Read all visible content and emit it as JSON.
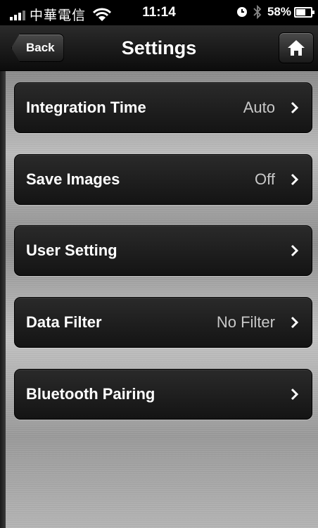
{
  "status_bar": {
    "carrier": "中華電信",
    "time": "11:14",
    "battery": "58%",
    "battery_level": 0.58,
    "signal_icon": "signal-bars-icon",
    "wifi_icon": "wifi-icon",
    "clock_icon": "clock-icon",
    "bluetooth_icon": "bluetooth-icon"
  },
  "nav": {
    "back_label": "Back",
    "title": "Settings",
    "home_icon": "home-icon"
  },
  "settings": [
    {
      "label": "Integration Time",
      "value": "Auto"
    },
    {
      "label": "Save Images",
      "value": "Off"
    },
    {
      "label": "User Setting",
      "value": ""
    },
    {
      "label": "Data Filter",
      "value": "No Filter"
    },
    {
      "label": "Bluetooth Pairing",
      "value": ""
    }
  ],
  "colors": {
    "row_background": "#1e1e1e",
    "value_text": "#c8c8c8",
    "background_metal": "#a8a8a8"
  }
}
